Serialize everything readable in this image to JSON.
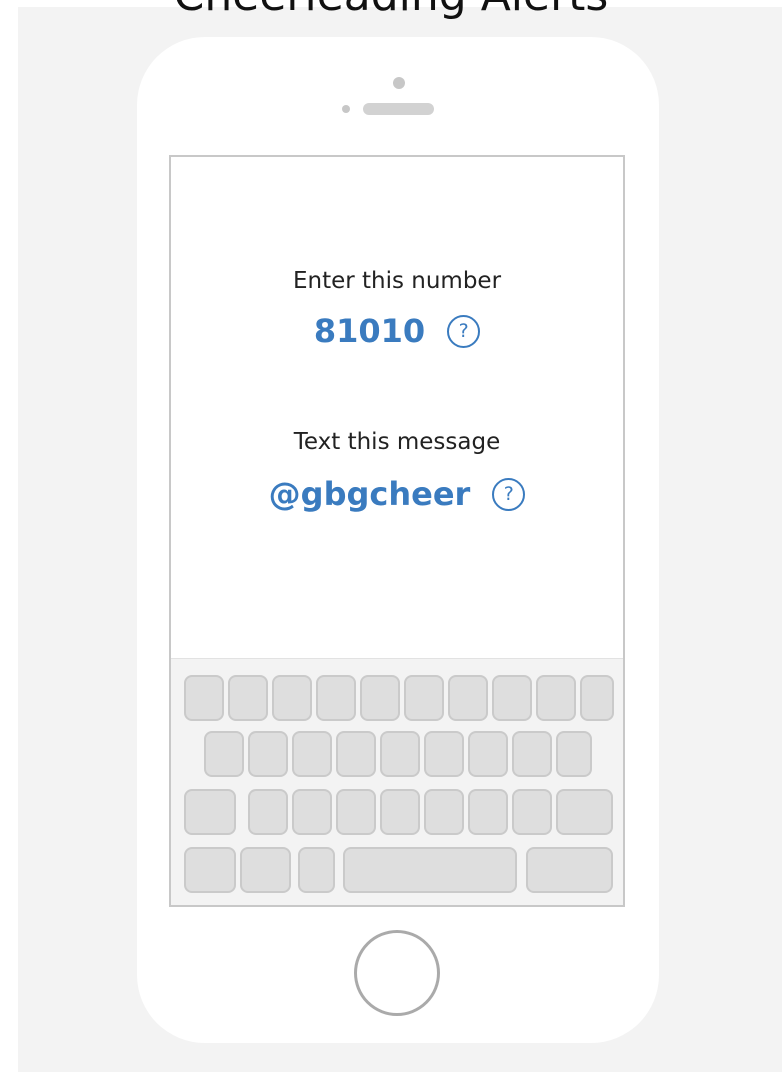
{
  "header": {
    "title": "Cheerleading Alerts"
  },
  "instructions": {
    "number_label": "Enter this number",
    "number_value": "81010",
    "message_label": "Text this message",
    "message_value": "@gbgcheer",
    "help_glyph": "?"
  },
  "icons": {
    "help": "question-circle-icon"
  },
  "colors": {
    "accent": "#3a7bbf",
    "panel_background": "#f3f3f3",
    "key_fill": "#dedede"
  }
}
